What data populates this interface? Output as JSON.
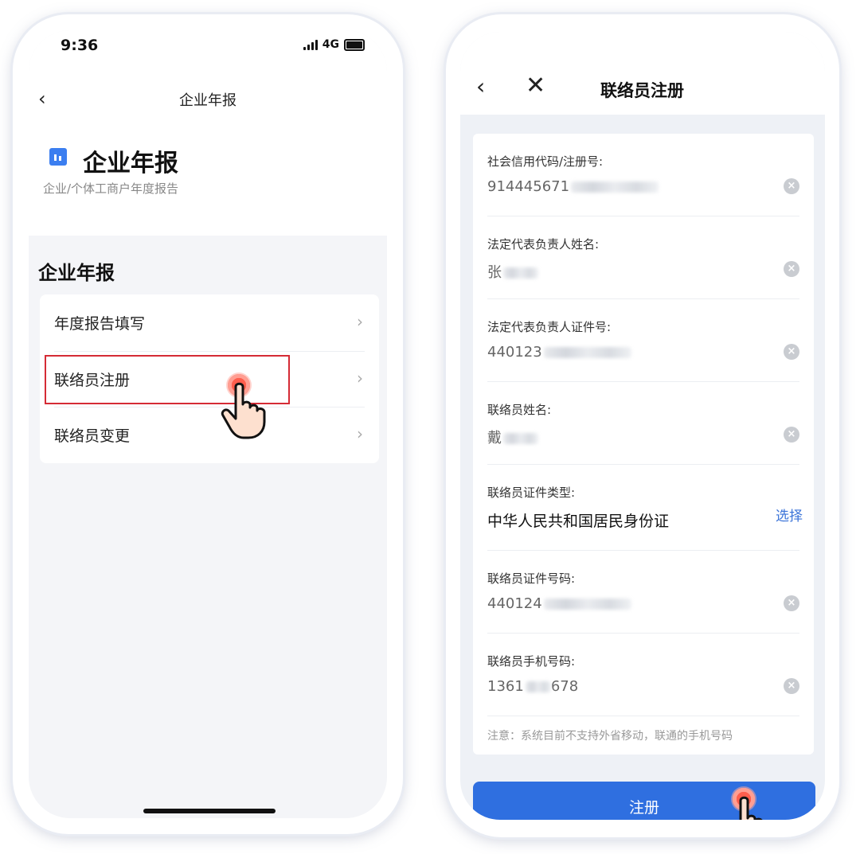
{
  "left_phone": {
    "status": {
      "time": "9:36",
      "network": "4G"
    },
    "nav": {
      "back_icon": "‹",
      "title": "企业年报"
    },
    "hero": {
      "title": "企业年报",
      "subtitle": "企业/个体工商户年度报告"
    },
    "section_title": "企业年报",
    "menu": [
      {
        "label": "年度报告填写",
        "chevron": "›"
      },
      {
        "label": "联络员注册",
        "chevron": "›"
      },
      {
        "label": "联络员变更",
        "chevron": "›"
      }
    ]
  },
  "right_phone": {
    "nav": {
      "back_icon": "‹",
      "close_icon": "✕",
      "title": "联络员注册"
    },
    "fields": [
      {
        "label": "社会信用代码/注册号:",
        "value": "914445671"
      },
      {
        "label": "法定代表负责人姓名:",
        "value": "张"
      },
      {
        "label": "法定代表负责人证件号:",
        "value": "440123"
      },
      {
        "label": "联络员姓名:",
        "value": "戴"
      },
      {
        "label": "联络员证件类型:",
        "value": "中华人民共和国居民身份证",
        "action": "选择"
      },
      {
        "label": "联络员证件号码:",
        "value": "440124"
      },
      {
        "label": "联络员手机号码:",
        "value_prefix": "1361",
        "value_suffix": "678"
      }
    ],
    "note": "注意：系统目前不支持外省移动，联通的手机号码",
    "submit_label": "注册"
  },
  "colors": {
    "accent": "#2f6fe0",
    "highlight": "#d52b35",
    "link": "#3a73d8"
  }
}
